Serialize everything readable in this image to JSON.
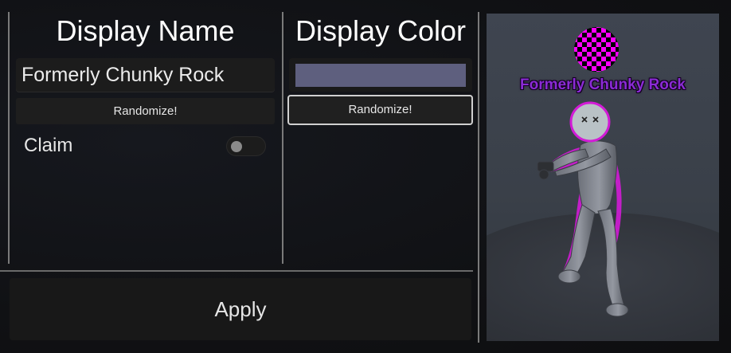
{
  "name_panel": {
    "title": "Display Name",
    "name_value": "Formerly Chunky Rock",
    "randomize_label": "Randomize!",
    "claim_label": "Claim",
    "claim_on": false
  },
  "color_panel": {
    "title": "Display Color",
    "swatch_color": "#5e5f7e",
    "randomize_label": "Randomize!"
  },
  "apply_label": "Apply",
  "preview": {
    "nameplate_text": "Formerly Chunky Rock",
    "nameplate_color": "#8b2bd6",
    "badge_colors": [
      "#ff00ff",
      "#000000"
    ],
    "outline_color": "#d21bd6",
    "face_icon": "x-eyes-face"
  }
}
